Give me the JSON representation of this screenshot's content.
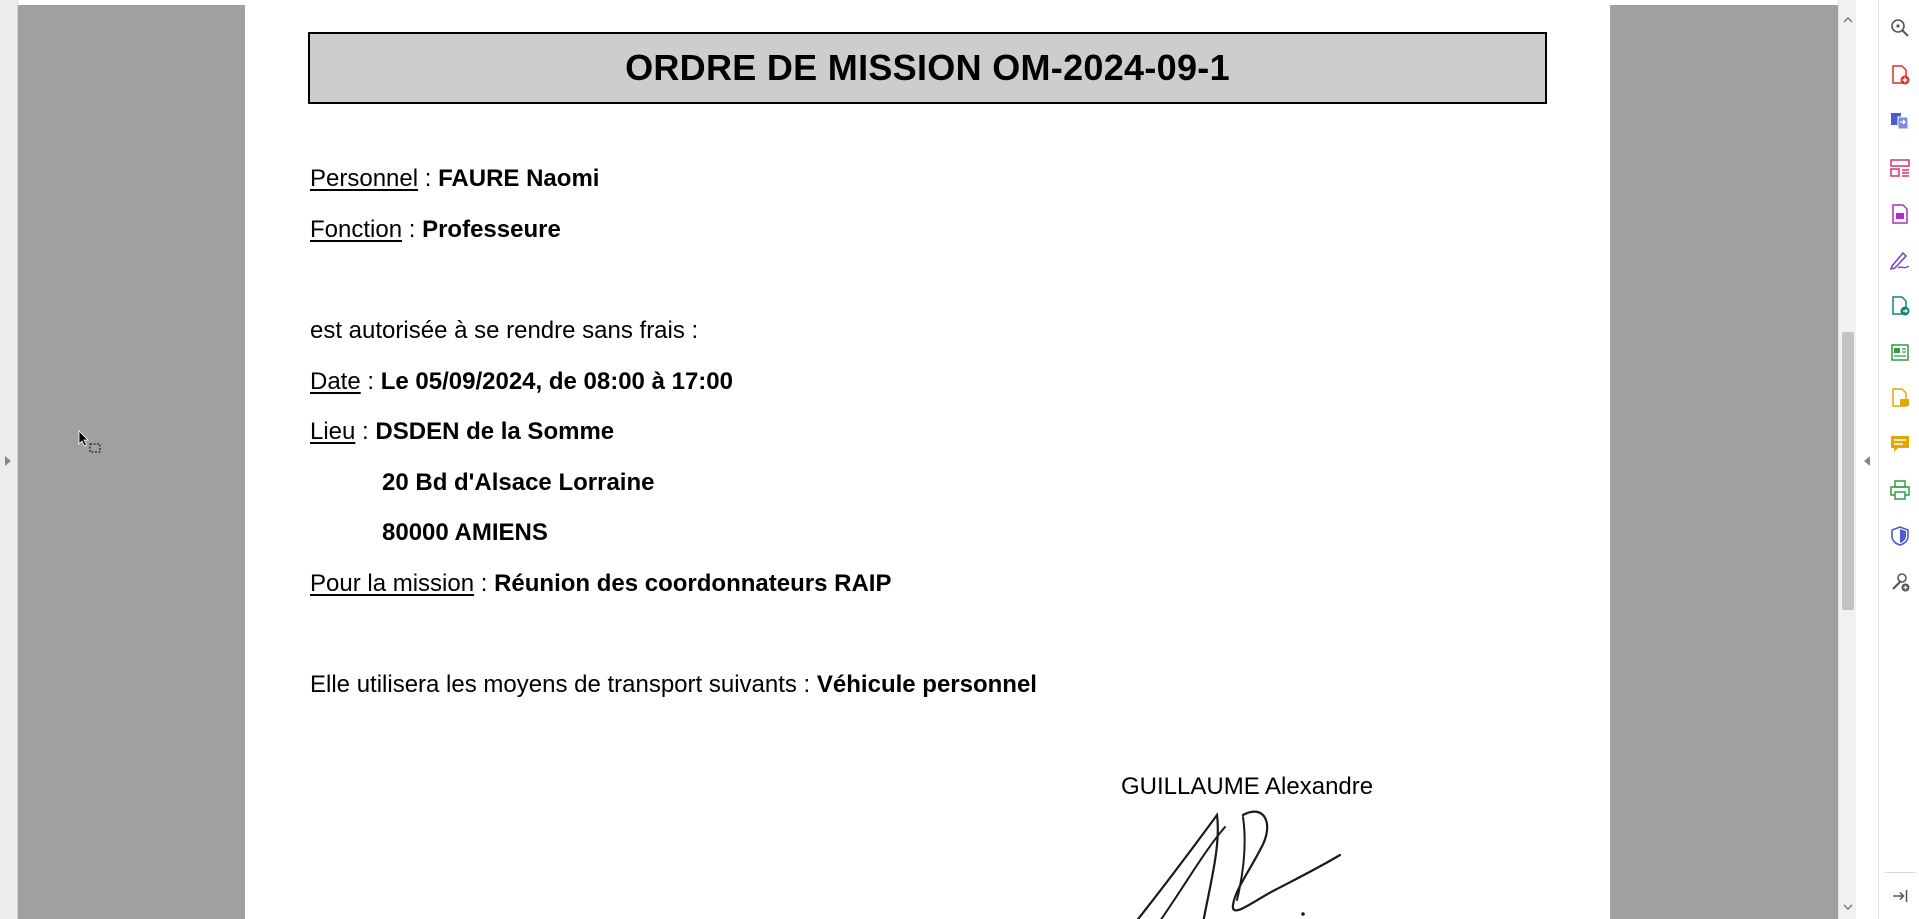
{
  "document": {
    "title": "ORDRE DE MISSION OM-2024-09-1",
    "personnel_label": "Personnel",
    "personnel_value": "FAURE Naomi",
    "fonction_label": "Fonction",
    "fonction_value": "Professeure",
    "authorization_text": "est autorisée à se rendre sans frais :",
    "date_label": "Date",
    "date_value": "Le 05/09/2024, de 08:00 à 17:00",
    "lieu_label": "Lieu",
    "lieu_line1": "DSDEN de la Somme",
    "lieu_line2": "20 Bd d'Alsace Lorraine",
    "lieu_line3": "80000 AMIENS",
    "mission_label": "Pour la mission",
    "mission_value": "Réunion des coordonnateurs RAIP",
    "transport_text": "Elle utilisera les moyens de transport suivants :",
    "transport_value": "Véhicule personnel",
    "signer_name": "GUILLAUME Alexandre",
    "colon": " : "
  },
  "tools_sidebar": {
    "items": [
      {
        "name": "zoom-icon",
        "color": "#555555"
      },
      {
        "name": "create-pdf-icon",
        "color": "#d9302c"
      },
      {
        "name": "combine-files-icon",
        "color": "#4b5bd6"
      },
      {
        "name": "organize-pages-icon",
        "color": "#d6336c"
      },
      {
        "name": "export-pdf-icon",
        "color": "#b02cc8"
      },
      {
        "name": "fill-sign-icon",
        "color": "#7b3fc8"
      },
      {
        "name": "send-for-signature-icon",
        "color": "#13837f"
      },
      {
        "name": "edit-pdf-icon",
        "color": "#2f9e44"
      },
      {
        "name": "comment-file-icon",
        "color": "#e0a800"
      },
      {
        "name": "comment-icon",
        "color": "#e0a800"
      },
      {
        "name": "print-production-icon",
        "color": "#2f9e44"
      },
      {
        "name": "protect-icon",
        "color": "#4b5bd6"
      },
      {
        "name": "more-tools-icon",
        "color": "#555555"
      },
      {
        "name": "collapse-panel-icon",
        "color": "#555555"
      }
    ]
  }
}
